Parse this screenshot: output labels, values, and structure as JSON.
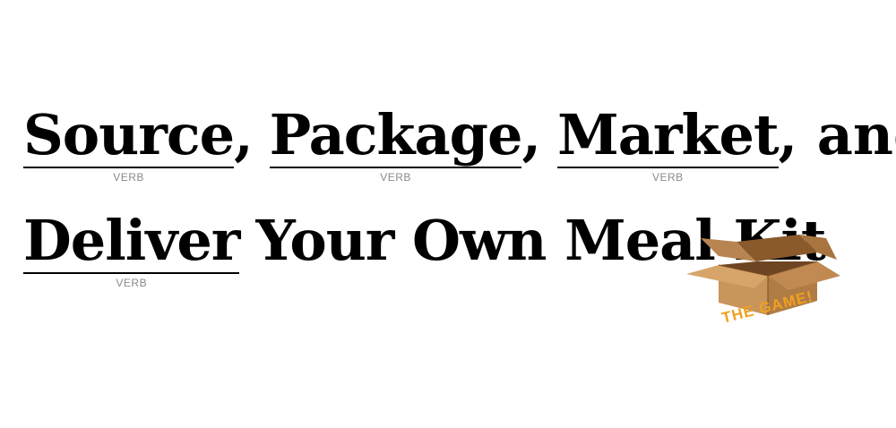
{
  "title": {
    "line1": [
      {
        "word": "Source",
        "tag": "VERB",
        "suffix": ","
      },
      {
        "word": "Package",
        "tag": "VERB",
        "suffix": ","
      },
      {
        "word": "Market",
        "tag": "VERB",
        "suffix": ", and"
      }
    ],
    "line2": {
      "blank": {
        "word": "Deliver",
        "tag": "VERB"
      },
      "rest": "Your Own Meal Kit"
    }
  },
  "game_caption": "THE GAME!",
  "colors": {
    "text": "#000000",
    "tag": "#8a8a8a",
    "caption": "#f0a020",
    "box": "#c8955a"
  },
  "icons": {
    "box": "open-cardboard-box-icon"
  }
}
